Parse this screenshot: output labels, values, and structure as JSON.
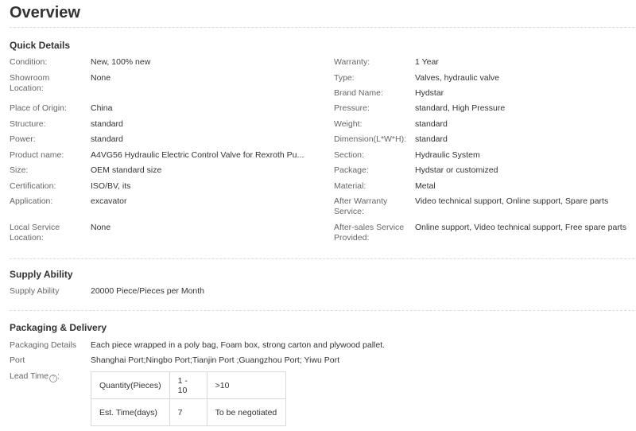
{
  "title": "Overview",
  "quick_details": {
    "heading": "Quick Details",
    "left": [
      {
        "label": "Condition:",
        "value": "New, 100% new"
      },
      {
        "label": "Showroom Location:",
        "value": "None"
      },
      {
        "label": "Place of Origin:",
        "value": "China"
      },
      {
        "label": "Structure:",
        "value": "standard"
      },
      {
        "label": "Power:",
        "value": "standard"
      },
      {
        "label": "Product name:",
        "value": "A4VG56 Hydraulic Electric Control Valve for Rexroth Pu..."
      },
      {
        "label": "Size:",
        "value": "OEM standard size"
      },
      {
        "label": "Certification:",
        "value": "ISO/BV, its"
      },
      {
        "label": "Application:",
        "value": "excavator"
      },
      {
        "label": "Local Service Location:",
        "value": "None"
      }
    ],
    "right": [
      {
        "label": "Warranty:",
        "value": "1 Year"
      },
      {
        "label": "Type:",
        "value": "Valves, hydraulic valve"
      },
      {
        "label": "Brand Name:",
        "value": "Hydstar"
      },
      {
        "label": "Pressure:",
        "value": "standard, High Pressure"
      },
      {
        "label": "Weight:",
        "value": "standard"
      },
      {
        "label": "Dimension(L*W*H):",
        "value": "standard"
      },
      {
        "label": "Section:",
        "value": "Hydraulic System"
      },
      {
        "label": "Package:",
        "value": "Hydstar or customized"
      },
      {
        "label": "Material:",
        "value": "Metal"
      },
      {
        "label": "After Warranty Service:",
        "value": "Video technical support, Online support, Spare parts"
      },
      {
        "label": "After-sales Service Provided:",
        "value": "Online support, Video technical support, Free spare parts"
      }
    ]
  },
  "supply_ability": {
    "heading": "Supply Ability",
    "label": "Supply Ability",
    "value": "20000 Piece/Pieces per Month"
  },
  "packaging_delivery": {
    "heading": "Packaging & Delivery",
    "packaging_label": "Packaging Details",
    "packaging_value": "Each piece wrapped in a poly bag, Foam box, strong carton and plywood pallet.",
    "port_label": "Port",
    "port_value": "Shanghai Port;Ningbo Port;Tianjin Port ;Guangzhou Port; Yiwu Port",
    "lead_time_label": "Lead Time",
    "lead_time_table": [
      [
        "Quantity(Pieces)",
        "1 - 10",
        ">10"
      ],
      [
        "Est. Time(days)",
        "7",
        "To be negotiated"
      ]
    ]
  }
}
